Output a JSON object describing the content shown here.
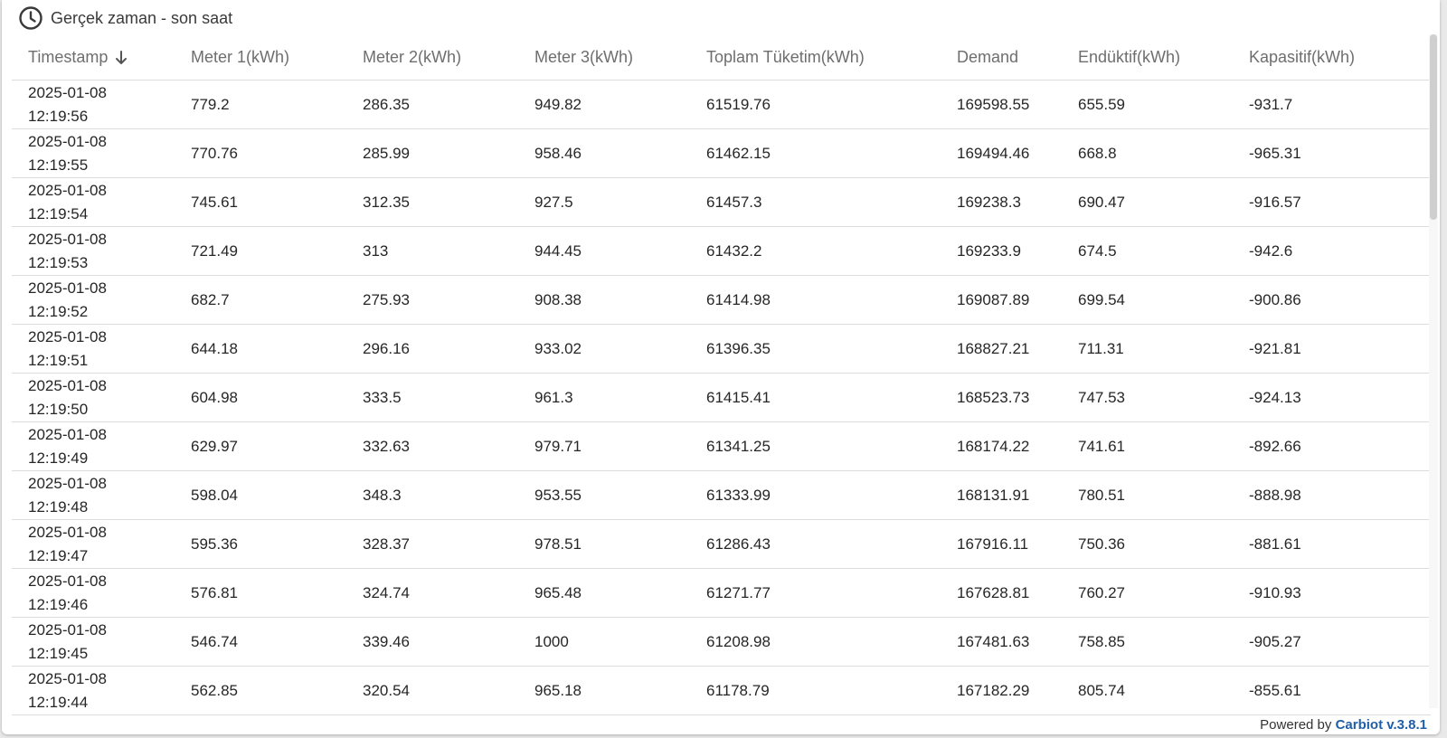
{
  "widget": {
    "title": "Gerçek zaman - son saat",
    "icon": "clock-icon"
  },
  "table": {
    "columns": [
      {
        "label": "Timestamp",
        "sort": "descending"
      },
      {
        "label": "Meter 1(kWh)"
      },
      {
        "label": "Meter 2(kWh)"
      },
      {
        "label": "Meter 3(kWh)"
      },
      {
        "label": "Toplam Tüketim(kWh)"
      },
      {
        "label": "Demand"
      },
      {
        "label": "Endüktif(kWh)"
      },
      {
        "label": "Kapasitif(kWh)"
      }
    ],
    "rows": [
      {
        "date": "2025-01-08",
        "time": "12:19:56",
        "values": [
          "779.2",
          "286.35",
          "949.82",
          "61519.76",
          "169598.55",
          "655.59",
          "-931.7"
        ]
      },
      {
        "date": "2025-01-08",
        "time": "12:19:55",
        "values": [
          "770.76",
          "285.99",
          "958.46",
          "61462.15",
          "169494.46",
          "668.8",
          "-965.31"
        ]
      },
      {
        "date": "2025-01-08",
        "time": "12:19:54",
        "values": [
          "745.61",
          "312.35",
          "927.5",
          "61457.3",
          "169238.3",
          "690.47",
          "-916.57"
        ]
      },
      {
        "date": "2025-01-08",
        "time": "12:19:53",
        "values": [
          "721.49",
          "313",
          "944.45",
          "61432.2",
          "169233.9",
          "674.5",
          "-942.6"
        ]
      },
      {
        "date": "2025-01-08",
        "time": "12:19:52",
        "values": [
          "682.7",
          "275.93",
          "908.38",
          "61414.98",
          "169087.89",
          "699.54",
          "-900.86"
        ]
      },
      {
        "date": "2025-01-08",
        "time": "12:19:51",
        "values": [
          "644.18",
          "296.16",
          "933.02",
          "61396.35",
          "168827.21",
          "711.31",
          "-921.81"
        ]
      },
      {
        "date": "2025-01-08",
        "time": "12:19:50",
        "values": [
          "604.98",
          "333.5",
          "961.3",
          "61415.41",
          "168523.73",
          "747.53",
          "-924.13"
        ]
      },
      {
        "date": "2025-01-08",
        "time": "12:19:49",
        "values": [
          "629.97",
          "332.63",
          "979.71",
          "61341.25",
          "168174.22",
          "741.61",
          "-892.66"
        ]
      },
      {
        "date": "2025-01-08",
        "time": "12:19:48",
        "values": [
          "598.04",
          "348.3",
          "953.55",
          "61333.99",
          "168131.91",
          "780.51",
          "-888.98"
        ]
      },
      {
        "date": "2025-01-08",
        "time": "12:19:47",
        "values": [
          "595.36",
          "328.37",
          "978.51",
          "61286.43",
          "167916.11",
          "750.36",
          "-881.61"
        ]
      },
      {
        "date": "2025-01-08",
        "time": "12:19:46",
        "values": [
          "576.81",
          "324.74",
          "965.48",
          "61271.77",
          "167628.81",
          "760.27",
          "-910.93"
        ]
      },
      {
        "date": "2025-01-08",
        "time": "12:19:45",
        "values": [
          "546.74",
          "339.46",
          "1000",
          "61208.98",
          "167481.63",
          "758.85",
          "-905.27"
        ]
      },
      {
        "date": "2025-01-08",
        "time": "12:19:44",
        "values": [
          "562.85",
          "320.54",
          "965.18",
          "61178.79",
          "167182.29",
          "805.74",
          "-855.61"
        ]
      }
    ]
  },
  "footer": {
    "prefix": "Powered by",
    "link": "Carbiot v.3.8.1"
  }
}
